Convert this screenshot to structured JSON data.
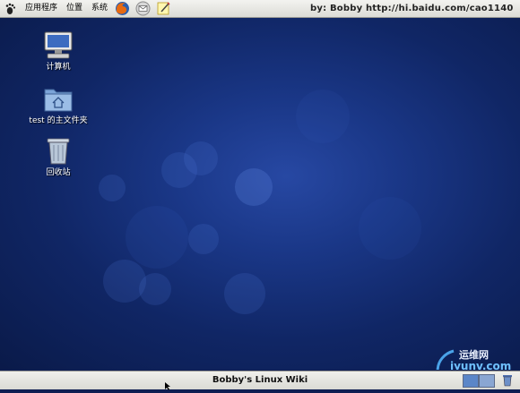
{
  "top_panel": {
    "menus": {
      "applications": "应用程序",
      "places": "位置",
      "system": "系统"
    },
    "launchers": [
      "firefox-icon",
      "mail-icon",
      "notes-icon"
    ],
    "watermark": "by: Bobby http://hi.baidu.com/cao1140"
  },
  "desktop": {
    "icons": [
      {
        "label": "计算机",
        "icon": "computer-icon"
      },
      {
        "label": "test 的主文件夹",
        "icon": "home-folder-icon"
      },
      {
        "label": "回收站",
        "icon": "trash-icon"
      }
    ]
  },
  "bottom_panel": {
    "title": "Bobby's Linux Wiki"
  },
  "watermark_logo": {
    "name": "运维网",
    "url": "iyunv.com"
  },
  "colors": {
    "desktop_bg": "#1a3787",
    "panel_bg": "#e6e6e0"
  }
}
